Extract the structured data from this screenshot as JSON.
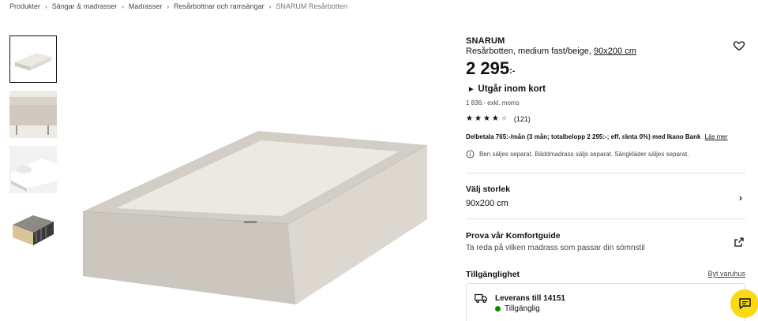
{
  "breadcrumb": [
    "Produkter",
    "Sängar & madrasser",
    "Madrasser",
    "Resårbottnar och ramsängar",
    "SNARUM Resårbotten"
  ],
  "thumbnails": [
    "bed-base-top",
    "bed-base-legs",
    "bed-with-bedding",
    "bed-base-cutaway"
  ],
  "product": {
    "name": "SNARUM",
    "description": "Resårbotten, medium fast/beige,",
    "size_link": "90x200 cm",
    "price": "2 295",
    "price_suffix": ":-",
    "status": "Utgår inom kort",
    "ex_vat": "1 836:- exkl. moms",
    "rating_stars": 4,
    "rating_max": 5,
    "review_count": "(121)",
    "finance_text": "Delbetala 765:-/mån (3 mån; totalbelopp 2 295:-; eff. ränta 0%) med Ikano Bank",
    "finance_link": "Läs mer",
    "note": "Ben säljes separat. Bäddmadrass säljs separat. Sängkläder säljes separat."
  },
  "size_selector": {
    "title": "Välj storlek",
    "value": "90x200 cm"
  },
  "comfort": {
    "title": "Prova vår Komfortguide",
    "subtitle": "Ta reda på vilken madrass som passar din sömnstil"
  },
  "availability": {
    "title": "Tillgänglighet",
    "change_store": "Byt varuhus",
    "delivery_title": "Leverans till 14151",
    "delivery_status": "Tillgänglig",
    "status_color": "#0a8a00"
  },
  "colors": {
    "accent": "#fbd914",
    "text": "#111111",
    "muted": "#484848",
    "product_fabric": "#d8d4cc"
  },
  "icons": {
    "favorite": "heart-icon",
    "chat": "chat-icon",
    "delivery": "truck-icon",
    "external": "external-link-icon",
    "info": "info-icon"
  }
}
